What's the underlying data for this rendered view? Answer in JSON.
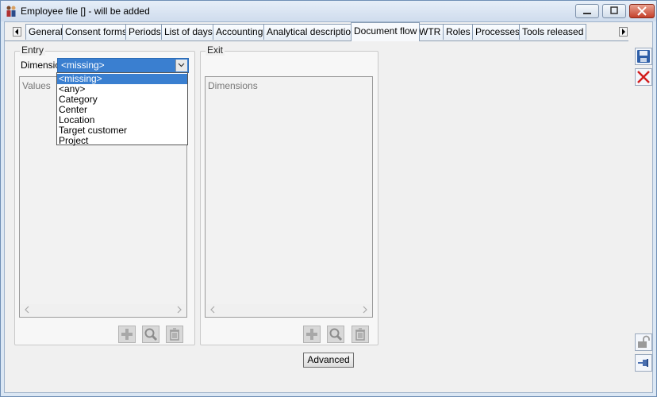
{
  "window": {
    "title": "Employee file [] - will be added",
    "minimize_icon": "minimize-icon",
    "maximize_icon": "maximize-icon",
    "close_icon": "close-icon"
  },
  "tabs": [
    {
      "label": "General"
    },
    {
      "label": "Consent forms"
    },
    {
      "label": "Periods"
    },
    {
      "label": "List of days"
    },
    {
      "label": "Accounting"
    },
    {
      "label": "Analytical description"
    },
    {
      "label": "Document flow",
      "active": true
    },
    {
      "label": "WTR"
    },
    {
      "label": "Roles"
    },
    {
      "label": "Processes"
    },
    {
      "label": "Tools released"
    }
  ],
  "entry": {
    "legend": "Entry",
    "dimension_label": "Dimension",
    "dimension_value": "<missing>",
    "dropdown_options": [
      "<missing>",
      "<any>",
      "Category",
      "Center",
      "Location",
      "Target customer",
      "Project"
    ],
    "values_label": "Values"
  },
  "exit": {
    "legend": "Exit",
    "dimensions_label": "Dimensions"
  },
  "buttons": {
    "advanced_label": "Advanced"
  },
  "icons": {
    "add": "plus-icon",
    "search": "magnifier-icon",
    "delete": "trash-icon",
    "save": "save-icon",
    "cancel": "cancel-x-icon",
    "unlock": "padlock-icon",
    "pin": "pin-icon"
  },
  "colors": {
    "accent": "#3a7fd0",
    "cancel": "#d21e1e"
  }
}
